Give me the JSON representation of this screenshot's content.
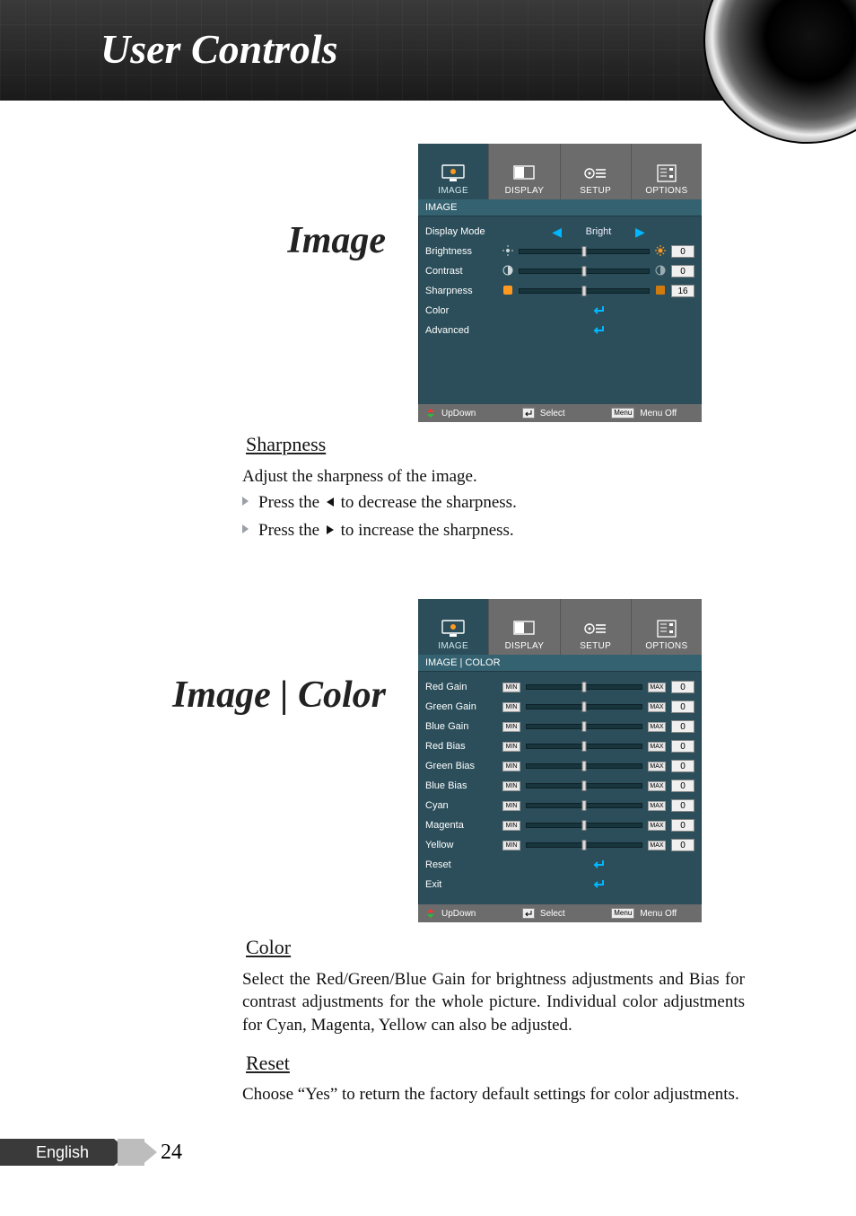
{
  "header": {
    "title": "User Controls"
  },
  "section1": {
    "heading": "Image",
    "osd": {
      "tabs": [
        "IMAGE",
        "DISPLAY",
        "SETUP",
        "OPTIONS"
      ],
      "crumb": "IMAGE",
      "items": {
        "display_mode": {
          "label": "Display Mode",
          "value": "Bright"
        },
        "brightness": {
          "label": "Brightness",
          "value": "0"
        },
        "contrast": {
          "label": "Contrast",
          "value": "0"
        },
        "sharpness": {
          "label": "Sharpness",
          "value": "16"
        },
        "color": {
          "label": "Color"
        },
        "advanced": {
          "label": "Advanced"
        }
      },
      "footer": {
        "updown": "UpDown",
        "select": "Select",
        "menu_key": "Menu",
        "menu_off": "Menu Off"
      }
    },
    "sharpness": {
      "heading": "Sharpness",
      "desc": "Adjust the sharpness of the image.",
      "b1a": "Press the ",
      "b1b": " to decrease the sharpness.",
      "b2a": "Press the ",
      "b2b": " to increase the sharpness."
    }
  },
  "section2": {
    "heading": "Image | Color",
    "osd": {
      "tabs": [
        "IMAGE",
        "DISPLAY",
        "SETUP",
        "OPTIONS"
      ],
      "crumb": "IMAGE | COLOR",
      "min": "MIN",
      "max": "MAX",
      "rows": [
        {
          "label": "Red Gain",
          "value": "0"
        },
        {
          "label": "Green Gain",
          "value": "0"
        },
        {
          "label": "Blue Gain",
          "value": "0"
        },
        {
          "label": "Red Bias",
          "value": "0"
        },
        {
          "label": "Green Bias",
          "value": "0"
        },
        {
          "label": "Blue Bias",
          "value": "0"
        },
        {
          "label": "Cyan",
          "value": "0"
        },
        {
          "label": "Magenta",
          "value": "0"
        },
        {
          "label": "Yellow",
          "value": "0"
        }
      ],
      "reset": "Reset",
      "exit": "Exit",
      "footer": {
        "updown": "UpDown",
        "select": "Select",
        "menu_key": "Menu",
        "menu_off": "Menu Off"
      }
    },
    "color": {
      "heading": "Color",
      "desc": "Select the Red/Green/Blue Gain for brightness adjustments and Bias for contrast adjustments for the whole picture. Individual color adjustments for Cyan, Magenta, Yellow can also be adjusted."
    },
    "reset": {
      "heading": "Reset",
      "desc": "Choose “Yes” to return the factory default settings for color adjustments."
    }
  },
  "footer": {
    "language": "English",
    "page": "24"
  }
}
